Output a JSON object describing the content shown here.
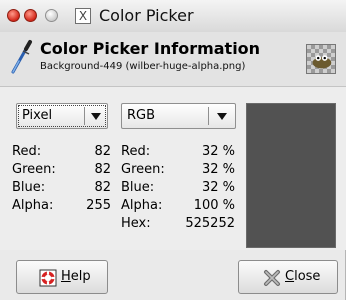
{
  "window": {
    "title": "Color Picker",
    "app_icon_glyph": "X"
  },
  "header": {
    "title": "Color Picker Information",
    "subtitle": "Background-449 (wilber-huge-alpha.png)",
    "icon": "color-picker-icon",
    "thumbnail_icon": "image-thumbnail"
  },
  "left_combo": {
    "selected": "Pixel"
  },
  "right_combo": {
    "selected": "RGB"
  },
  "pixel_values": [
    {
      "label": "Red:",
      "value": "82"
    },
    {
      "label": "Green:",
      "value": "82"
    },
    {
      "label": "Blue:",
      "value": "82"
    },
    {
      "label": "Alpha:",
      "value": "255"
    }
  ],
  "rgb_values": [
    {
      "label": "Red:",
      "value": "32 %"
    },
    {
      "label": "Green:",
      "value": "32 %"
    },
    {
      "label": "Blue:",
      "value": "32 %"
    },
    {
      "label": "Alpha:",
      "value": "100 %"
    },
    {
      "label": "Hex:",
      "value": "525252"
    }
  ],
  "swatch": {
    "color": "#525252"
  },
  "buttons": {
    "help": "Help",
    "close": "Close"
  }
}
